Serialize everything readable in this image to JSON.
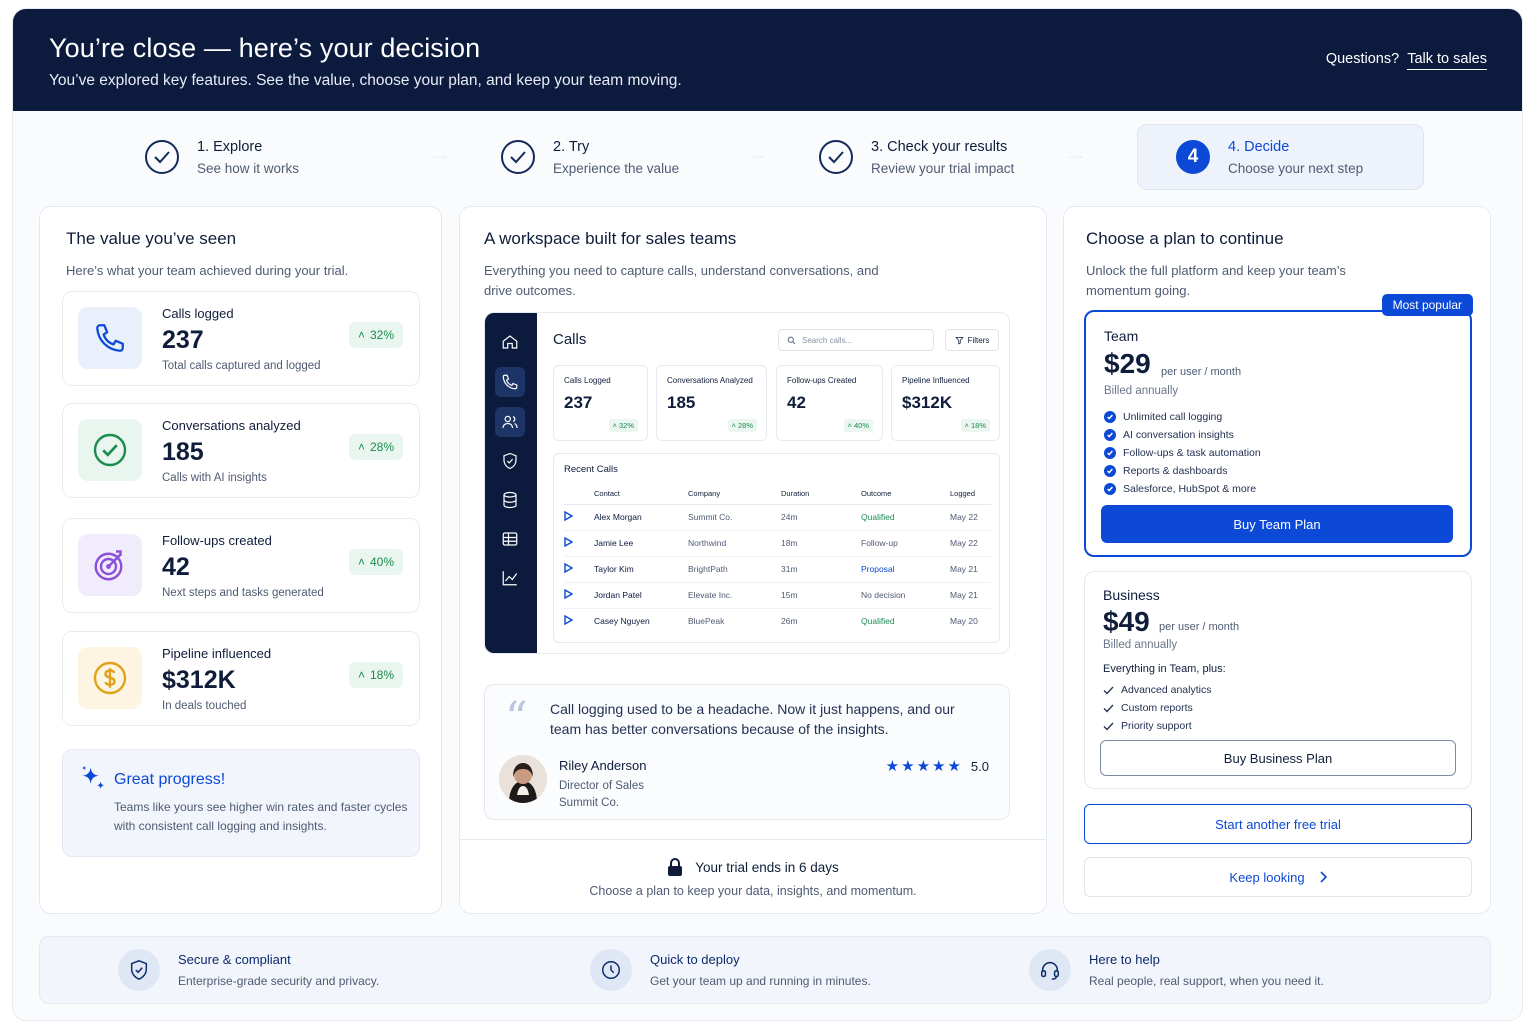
{
  "header": {
    "title": "You’re close — here’s your decision",
    "subtitle": "You’ve explored key features. See the value, choose your plan, and keep your team moving.",
    "help_prefix": "Questions?",
    "help_link": "Talk to sales"
  },
  "steps": [
    {
      "title": "1. Explore",
      "desc": "See how it works"
    },
    {
      "title": "2. Try",
      "desc": "Experience the value"
    },
    {
      "title": "3. Check your results",
      "desc": "Review your trial impact"
    },
    {
      "number": "4",
      "title": "4. Decide",
      "desc": "Choose your next step"
    }
  ],
  "value": {
    "title": "The value you’ve seen",
    "subtitle": "Here’s what your team achieved during your trial.",
    "stats": [
      {
        "label": "Calls logged",
        "value": "237",
        "desc": "Total calls captured and logged",
        "change": "32%",
        "icon": "phone-icon"
      },
      {
        "label": "Conversations analyzed",
        "value": "185",
        "desc": "Calls with AI insights",
        "change": "28%",
        "icon": "check-circle-icon"
      },
      {
        "label": "Follow-ups created",
        "value": "42",
        "desc": "Next steps and tasks generated",
        "change": "40%",
        "icon": "target-icon"
      },
      {
        "label": "Pipeline influenced",
        "value": "$312K",
        "desc": "In deals touched",
        "change": "18%",
        "icon": "dollar-icon"
      }
    ],
    "progress_title": "Great progress!",
    "progress_desc": "Teams like yours see higher win rates and faster cycles with consistent call logging and insights."
  },
  "workspace": {
    "title": "A workspace built for sales teams",
    "subtitle": "Everything you need to capture calls, understand conversations, and drive outcomes.",
    "app": {
      "title": "Calls",
      "search_placeholder": "Search calls...",
      "filters": "Filters",
      "metrics": [
        {
          "label": "Calls Logged",
          "value": "237",
          "change": "32%"
        },
        {
          "label": "Conversations Analyzed",
          "value": "185",
          "change": "28%"
        },
        {
          "label": "Follow-ups Created",
          "value": "42",
          "change": "40%"
        },
        {
          "label": "Pipeline Influenced",
          "value": "$312K",
          "change": "18%"
        }
      ],
      "recent_title": "Recent Calls",
      "columns": [
        "Contact",
        "Company",
        "Duration",
        "Outcome",
        "Logged"
      ],
      "rows": [
        {
          "contact": "Alex Morgan",
          "company": "Summit Co.",
          "duration": "24m",
          "outcome": "Qualified",
          "logged": "May 22"
        },
        {
          "contact": "Jamie Lee",
          "company": "Northwind",
          "duration": "18m",
          "outcome": "Follow-up",
          "logged": "May 22"
        },
        {
          "contact": "Taylor Kim",
          "company": "BrightPath",
          "duration": "31m",
          "outcome": "Proposal",
          "logged": "May 21"
        },
        {
          "contact": "Jordan Patel",
          "company": "Elevate Inc.",
          "duration": "15m",
          "outcome": "No decision",
          "logged": "May 21"
        },
        {
          "contact": "Casey Nguyen",
          "company": "BluePeak",
          "duration": "26m",
          "outcome": "Qualified",
          "logged": "May 20"
        }
      ]
    },
    "quote": {
      "text": "Call logging used to be a headache. Now it just happens, and our team has better conversations because of the insights.",
      "name": "Riley Anderson",
      "role": "Director of Sales",
      "company": "Summit Co.",
      "rating": "5.0"
    },
    "trial_title": "Your trial ends in 6 days",
    "trial_desc": "Choose a plan to keep your data, insights, and momentum."
  },
  "plans": {
    "title": "Choose a plan to continue",
    "subtitle": "Unlock the full platform and keep your team’s momentum going.",
    "team": {
      "badge": "Most popular",
      "name": "Team",
      "price": "$29",
      "unit": "per user / month",
      "billing": "Billed annually",
      "features": [
        "Unlimited call logging",
        "AI conversation insights",
        "Follow-ups & task automation",
        "Reports & dashboards",
        "Salesforce, HubSpot & more"
      ],
      "cta": "Buy Team Plan"
    },
    "business": {
      "name": "Business",
      "price": "$49",
      "unit": "per user / month",
      "billing": "Billed annually",
      "intro": "Everything in Team, plus:",
      "features": [
        "Advanced analytics",
        "Custom reports",
        "Priority support"
      ],
      "cta": "Buy Business Plan"
    },
    "trial_cta": "Start another free trial",
    "keep_looking": "Keep looking"
  },
  "trust": [
    {
      "title": "Secure & compliant",
      "desc": "Enterprise-grade security and privacy.",
      "icon": "shield-icon"
    },
    {
      "title": "Quick to deploy",
      "desc": "Get your team up and running in minutes.",
      "icon": "clock-icon"
    },
    {
      "title": "Here to help",
      "desc": "Real people, real support, when you need it.",
      "icon": "headset-icon"
    }
  ],
  "colors": {
    "navy": "#0b1a3d",
    "accent": "#0b49d6",
    "positive": "#1b8b4f"
  }
}
